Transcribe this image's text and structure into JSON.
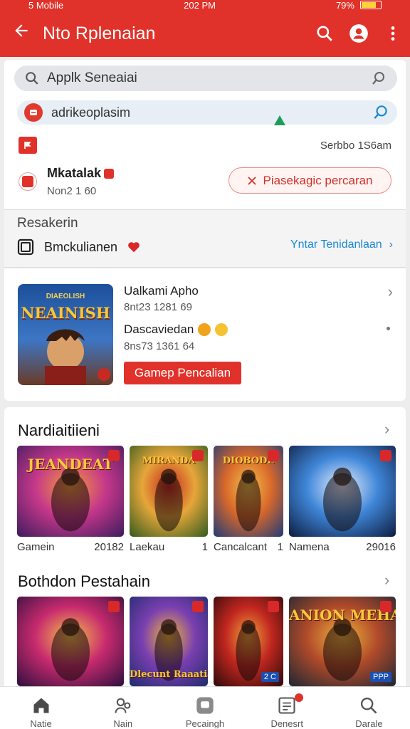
{
  "status": {
    "time": "202 PM",
    "carrier": "5 Mobile",
    "battery": "79%"
  },
  "appbar": {
    "title": "Nto Rplenaian"
  },
  "search": {
    "placeholder": "Applk Seneaiai"
  },
  "subsearch": {
    "value": "adrikeoplasim"
  },
  "info": {
    "right_text": "Serbbo 1S6am"
  },
  "account": {
    "name": "Mkatalak",
    "sub": "Non2 1 60",
    "action": "Piasekagic percaran"
  },
  "section": {
    "title": "Resakerin",
    "item_label": "Bmckulianen",
    "link": "Yntar Tenidanlaan"
  },
  "featured": {
    "cover_text": "NEAINISH",
    "cover_small": "DIAEOLISH",
    "title": "Ualkami Apho",
    "meta1": "8nt23 1281 69",
    "label2": "Dascaviedan",
    "meta2": "8ns73 1361 64",
    "button": "Gamep Pencalian"
  },
  "list1": {
    "title": "Nardiaitiieni",
    "items": [
      {
        "art": "JEANDEAT",
        "caption": "Gamein",
        "value": "20182",
        "colors": [
          "#3b1b5c",
          "#c4378a",
          "#f59b3a"
        ]
      },
      {
        "art": "MIRANDA",
        "caption": "Laekau",
        "value": "1",
        "colors": [
          "#2f5a1e",
          "#e6a63a",
          "#c8261f"
        ]
      },
      {
        "art": "DIOBODE",
        "caption": "Cancalcant",
        "value": "1",
        "colors": [
          "#1c3a7a",
          "#d8682a",
          "#f4c14a"
        ]
      },
      {
        "art": "",
        "caption": "Namena",
        "value": "29016",
        "colors": [
          "#0d1b3e",
          "#3f86d8",
          "#e9f0ff"
        ]
      }
    ]
  },
  "list2": {
    "title": "Bothdon Pestahain",
    "items": [
      {
        "art": "",
        "badge": "",
        "colors": [
          "#2b0f3d",
          "#c72a6e",
          "#f5c04a"
        ]
      },
      {
        "art": "Dlecunt Raaatian",
        "badge": "",
        "colors": [
          "#1d2b6b",
          "#7a3fb0",
          "#f3b63a"
        ]
      },
      {
        "art": "",
        "badge": "2 C",
        "colors": [
          "#2a0a0a",
          "#c0261f",
          "#f2a23b"
        ]
      },
      {
        "art": "ANION MEHA",
        "badge": "PPP",
        "colors": [
          "#1a2633",
          "#b04a2a",
          "#f0b43c"
        ]
      }
    ]
  },
  "nav": [
    {
      "label": "Natie",
      "icon": "home-icon"
    },
    {
      "label": "Nain",
      "icon": "users-icon"
    },
    {
      "label": "Pecaingh",
      "icon": "chat-icon"
    },
    {
      "label": "Denesrt",
      "icon": "list-icon"
    },
    {
      "label": "Darale",
      "icon": "search-icon"
    }
  ],
  "colors": {
    "brand": "#e0322a",
    "link": "#1a87d0"
  }
}
